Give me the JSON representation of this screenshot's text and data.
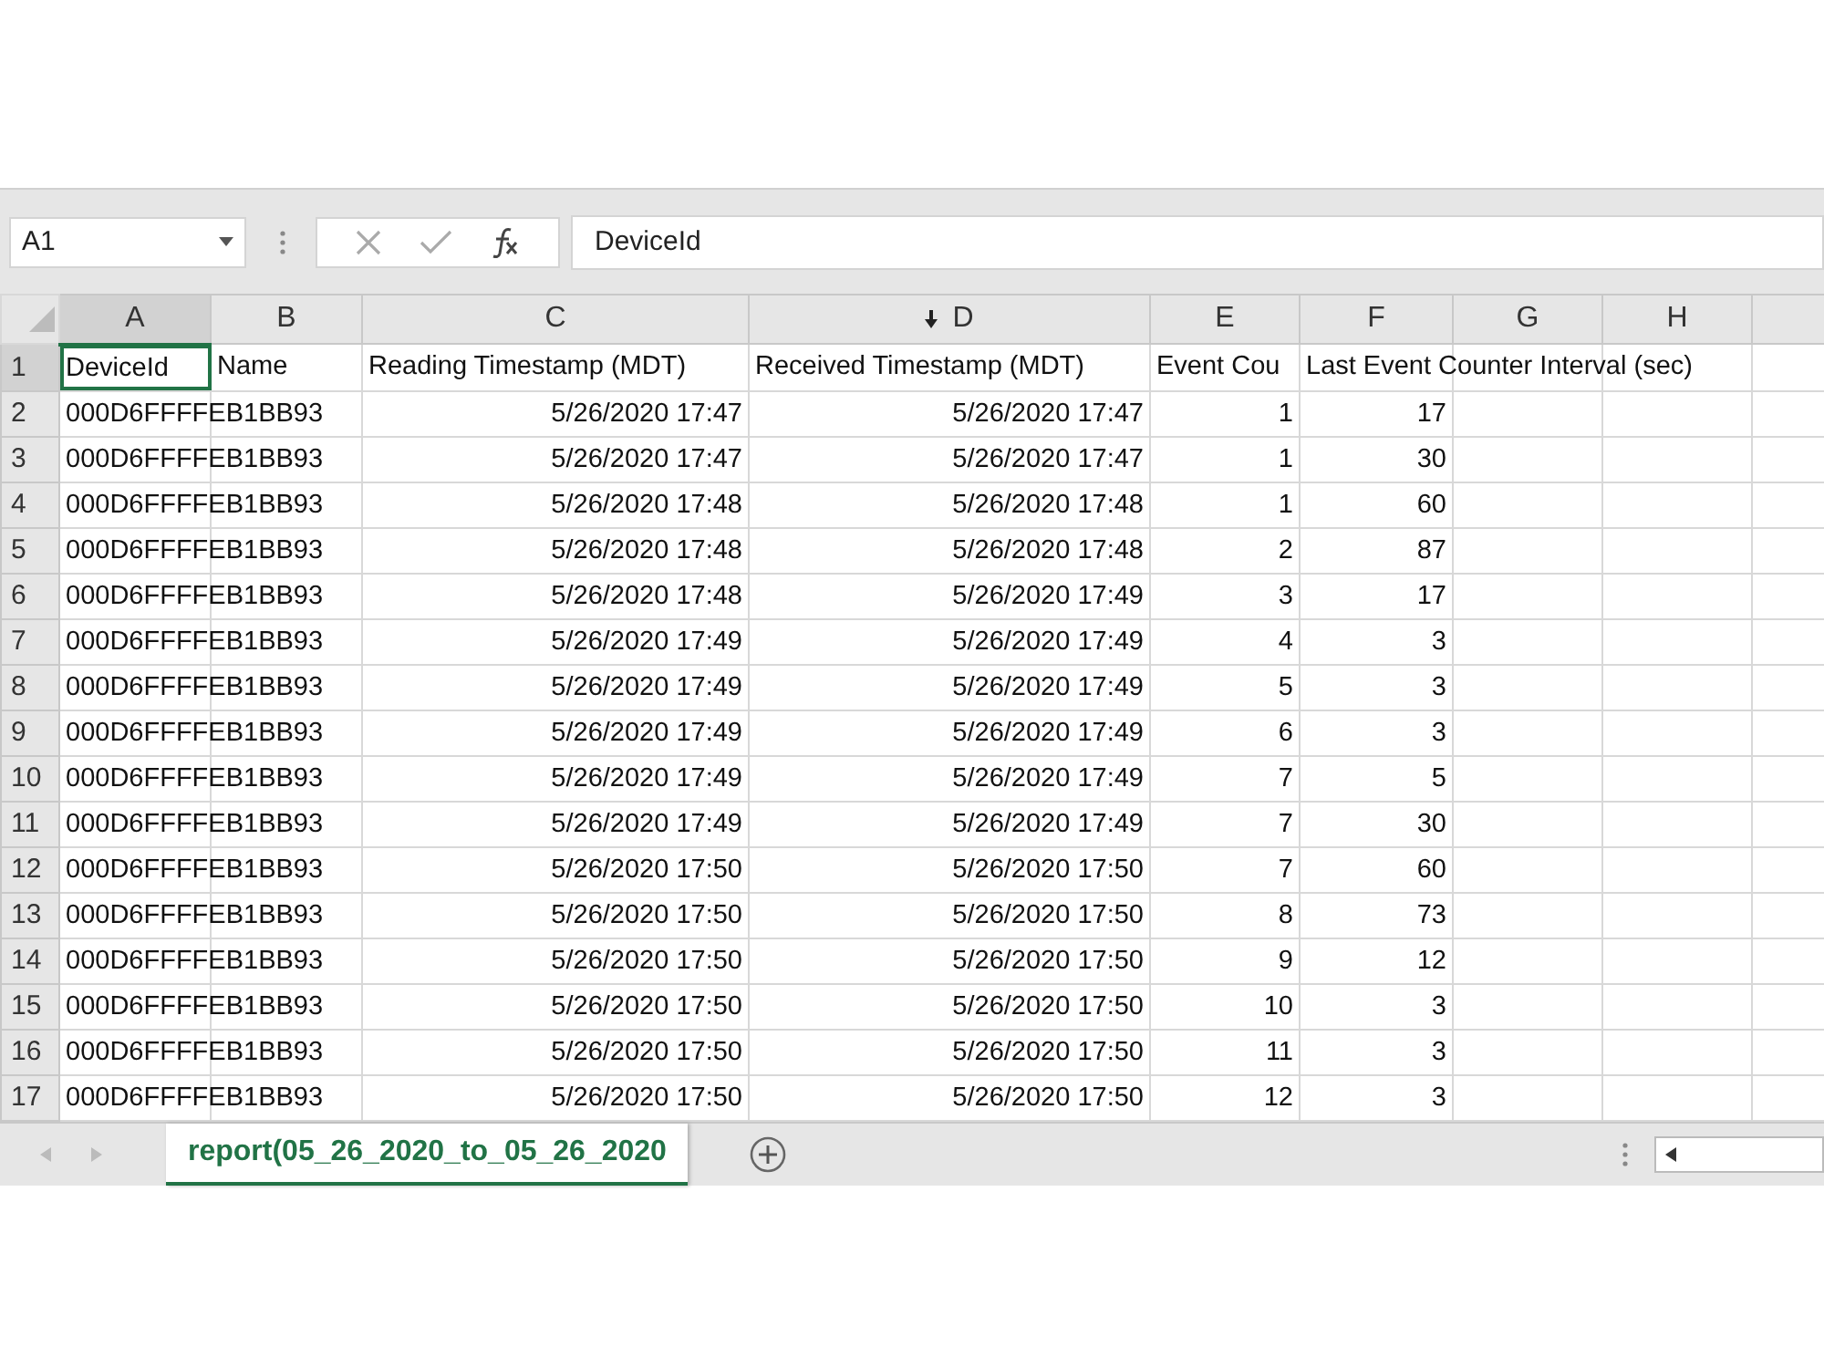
{
  "name_box": "A1",
  "formula_bar": {
    "value": "DeviceId"
  },
  "columns": [
    {
      "label": "A",
      "selected": true,
      "sorted": false
    },
    {
      "label": "B",
      "selected": false,
      "sorted": false
    },
    {
      "label": "C",
      "selected": false,
      "sorted": false
    },
    {
      "label": "D",
      "selected": false,
      "sorted": true
    },
    {
      "label": "E",
      "selected": false,
      "sorted": false
    },
    {
      "label": "F",
      "selected": false,
      "sorted": false
    },
    {
      "label": "G",
      "selected": false,
      "sorted": false
    },
    {
      "label": "H",
      "selected": false,
      "sorted": false
    }
  ],
  "rows": [
    {
      "number": "1",
      "selected": true,
      "cells": [
        "DeviceId",
        "Name",
        "Reading Timestamp (MDT)",
        "Received Timestamp (MDT)",
        "Event Cou",
        "Last Event Counter Interval (sec)"
      ]
    },
    {
      "number": "2",
      "selected": false,
      "cells": [
        "000D6FFFFEB1BB93",
        "",
        "5/26/2020 17:47",
        "5/26/2020 17:47",
        "1",
        "17"
      ]
    },
    {
      "number": "3",
      "selected": false,
      "cells": [
        "000D6FFFFEB1BB93",
        "",
        "5/26/2020 17:47",
        "5/26/2020 17:47",
        "1",
        "30"
      ]
    },
    {
      "number": "4",
      "selected": false,
      "cells": [
        "000D6FFFFEB1BB93",
        "",
        "5/26/2020 17:48",
        "5/26/2020 17:48",
        "1",
        "60"
      ]
    },
    {
      "number": "5",
      "selected": false,
      "cells": [
        "000D6FFFFEB1BB93",
        "",
        "5/26/2020 17:48",
        "5/26/2020 17:48",
        "2",
        "87"
      ]
    },
    {
      "number": "6",
      "selected": false,
      "cells": [
        "000D6FFFFEB1BB93",
        "",
        "5/26/2020 17:48",
        "5/26/2020 17:49",
        "3",
        "17"
      ]
    },
    {
      "number": "7",
      "selected": false,
      "cells": [
        "000D6FFFFEB1BB93",
        "",
        "5/26/2020 17:49",
        "5/26/2020 17:49",
        "4",
        "3"
      ]
    },
    {
      "number": "8",
      "selected": false,
      "cells": [
        "000D6FFFFEB1BB93",
        "",
        "5/26/2020 17:49",
        "5/26/2020 17:49",
        "5",
        "3"
      ]
    },
    {
      "number": "9",
      "selected": false,
      "cells": [
        "000D6FFFFEB1BB93",
        "",
        "5/26/2020 17:49",
        "5/26/2020 17:49",
        "6",
        "3"
      ]
    },
    {
      "number": "10",
      "selected": false,
      "cells": [
        "000D6FFFFEB1BB93",
        "",
        "5/26/2020 17:49",
        "5/26/2020 17:49",
        "7",
        "5"
      ]
    },
    {
      "number": "11",
      "selected": false,
      "cells": [
        "000D6FFFFEB1BB93",
        "",
        "5/26/2020 17:49",
        "5/26/2020 17:49",
        "7",
        "30"
      ]
    },
    {
      "number": "12",
      "selected": false,
      "cells": [
        "000D6FFFFEB1BB93",
        "",
        "5/26/2020 17:50",
        "5/26/2020 17:50",
        "7",
        "60"
      ]
    },
    {
      "number": "13",
      "selected": false,
      "cells": [
        "000D6FFFFEB1BB93",
        "",
        "5/26/2020 17:50",
        "5/26/2020 17:50",
        "8",
        "73"
      ]
    },
    {
      "number": "14",
      "selected": false,
      "cells": [
        "000D6FFFFEB1BB93",
        "",
        "5/26/2020 17:50",
        "5/26/2020 17:50",
        "9",
        "12"
      ]
    },
    {
      "number": "15",
      "selected": false,
      "cells": [
        "000D6FFFFEB1BB93",
        "",
        "5/26/2020 17:50",
        "5/26/2020 17:50",
        "10",
        "3"
      ]
    },
    {
      "number": "16",
      "selected": false,
      "cells": [
        "000D6FFFFEB1BB93",
        "",
        "5/26/2020 17:50",
        "5/26/2020 17:50",
        "11",
        "3"
      ]
    },
    {
      "number": "17",
      "selected": false,
      "cells": [
        "000D6FFFFEB1BB93",
        "",
        "5/26/2020 17:50",
        "5/26/2020 17:50",
        "12",
        "3"
      ]
    }
  ],
  "sheet_tabs": [
    {
      "label": "report(05_26_2020_to_05_26_2020",
      "selected": true
    }
  ]
}
